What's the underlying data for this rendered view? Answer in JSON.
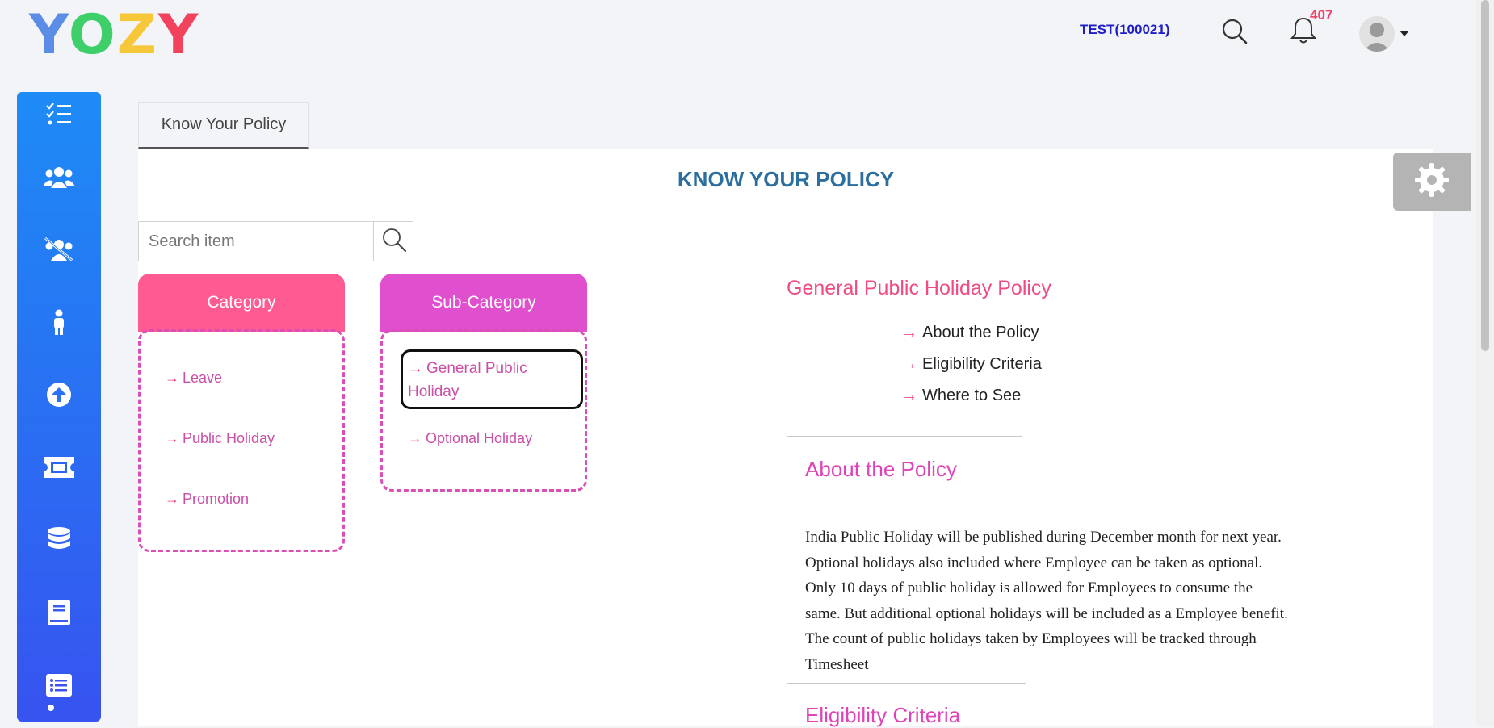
{
  "brand": {
    "logo_letters": [
      "Y",
      "O",
      "Z",
      "Y"
    ]
  },
  "topbar": {
    "user_label": "TEST(100021)",
    "notification_count": "407",
    "icons": [
      "search-icon",
      "bell-icon",
      "avatar",
      "chevron-down-icon"
    ]
  },
  "sidebar": {
    "items": [
      {
        "icon": "checklist-icon"
      },
      {
        "icon": "users-icon"
      },
      {
        "icon": "users-slash-icon"
      },
      {
        "icon": "person-icon"
      },
      {
        "icon": "arrow-up-circle-icon"
      },
      {
        "icon": "ticket-icon"
      },
      {
        "icon": "database-icon"
      },
      {
        "icon": "book-icon",
        "active": true
      },
      {
        "icon": "list-alt-icon"
      }
    ]
  },
  "tab": {
    "label": "Know Your Policy"
  },
  "main": {
    "title": "KNOW YOUR POLICY",
    "search": {
      "placeholder": "Search item"
    },
    "category": {
      "header": "Category",
      "items": [
        "Leave",
        "Public Holiday",
        "Promotion"
      ]
    },
    "subcategory": {
      "header": "Sub-Category",
      "items": [
        "General Public Holiday",
        "Optional Holiday"
      ],
      "selected": "General Public Holiday"
    },
    "policy": {
      "heading": "General Public Holiday Policy",
      "toc": [
        "About the Policy",
        "Eligibility Criteria",
        "Where to See"
      ],
      "about_heading": "About the Policy",
      "about_text": "India Public Holiday will be published during December month for next year. Optional holidays also included where Employee can be taken as optional. Only 10 days of public holiday is allowed for Employees to consume the same. But additional optional holidays will be included as a Employee benefit. The count of public holidays taken by Employees will be tracked through Timesheet",
      "eligibility_heading": "Eligibility Criteria"
    }
  },
  "colors": {
    "sidebar_top": "#1e8bf6",
    "sidebar_bottom": "#3753f0",
    "category_header": "#ff5b92",
    "subcategory_header": "#df4fce",
    "link_pink": "#c94fa7",
    "title_blue": "#2c6e9e"
  }
}
